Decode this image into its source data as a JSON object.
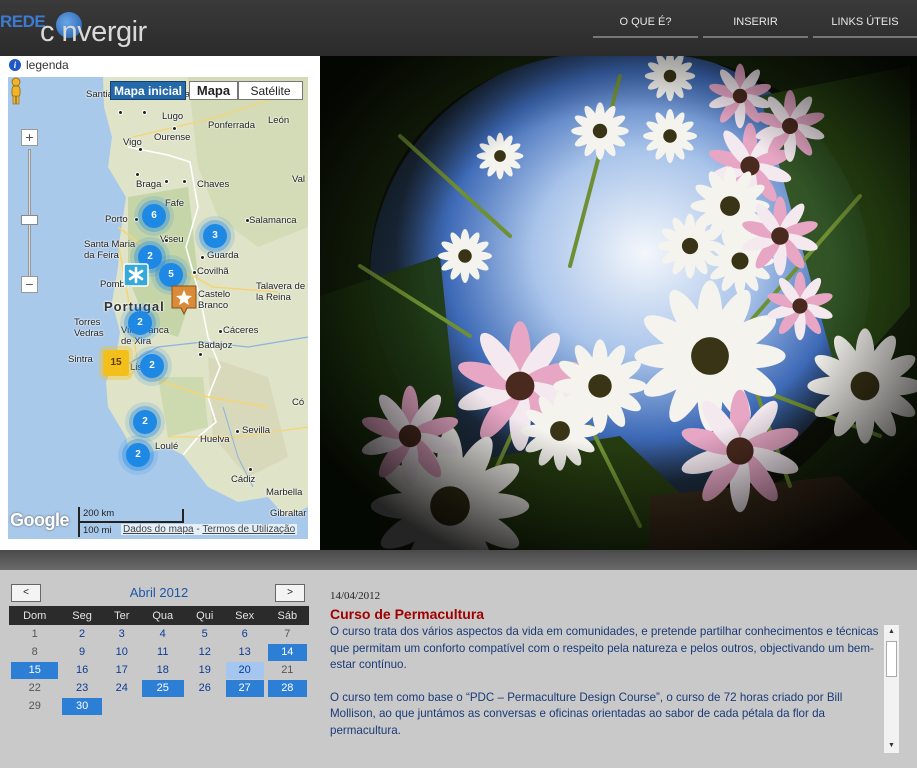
{
  "header": {
    "logo_prefix": "REDE",
    "logo_name": "c nvergir",
    "nav": [
      "O QUE É?",
      "INSERIR PROJECTO",
      "LINKS ÚTEIS"
    ]
  },
  "map": {
    "legend_label": "legenda",
    "buttons": {
      "initial": "Mapa inicial",
      "map": "Mapa",
      "satellite": "Satélite"
    },
    "google_label": "Google",
    "scale_km": "200 km",
    "scale_mi": "100 mi",
    "footer_data": "Dados do mapa",
    "footer_sep": " - ",
    "footer_terms": "Termos de Utilização",
    "cities": [
      "Santiago de Compostela",
      "Lugo",
      "Ourense",
      "Ponferrada",
      "León",
      "Vigo",
      "Braga",
      "Chaves",
      "Val",
      "Porto",
      "Fafe",
      "Viseu",
      "Salamanca",
      "Santa Maria da Feira",
      "Guarda",
      "Covilhã",
      "Pombal",
      "Castelo Branco",
      "Talavera de la Reina",
      "Torres Vedras",
      "Vila Franca de Xira",
      "Cáceres",
      "Sintra",
      "Lisboa",
      "Badajoz",
      "Có",
      "Sevilla",
      "Loulé",
      "Huelva",
      "Cádiz",
      "Marbella",
      "Gibraltar",
      "Portugal"
    ],
    "clusters": [
      "6",
      "3",
      "2",
      "5",
      "2",
      "15",
      "2",
      "2",
      "2"
    ]
  },
  "calendar": {
    "prev_label": "<",
    "next_label": ">",
    "month": "Abril 2012",
    "weekdays": [
      "Dom",
      "Seg",
      "Ter",
      "Qua",
      "Qui",
      "Sex",
      "Sáb"
    ],
    "weeks": [
      [
        "1",
        "2",
        "3",
        "4",
        "5",
        "6",
        "7"
      ],
      [
        "8",
        "9",
        "10",
        "11",
        "12",
        "13",
        "14"
      ],
      [
        "15",
        "16",
        "17",
        "18",
        "19",
        "20",
        "21"
      ],
      [
        "22",
        "23",
        "24",
        "25",
        "26",
        "27",
        "28"
      ],
      [
        "29",
        "30",
        "",
        "",
        "",
        "",
        ""
      ]
    ]
  },
  "event": {
    "date": "14/04/2012",
    "title": "Curso de Permacultura",
    "paragraphs": [
      "O curso trata dos vários aspectos da vida em comunidades, e pretende partilhar conhecimentos e técnicas que permitam um conforto compatível com o respeito pela natureza e pelos outros, objectivando um bem-estar contínuo.",
      "O curso tem como base o “PDC – Permaculture Design Course”, o curso de 72 horas criado por Bill Mollison, ao que juntámos as conversas e oficinas orientadas ao sabor de cada pétala da flor da permacultura."
    ]
  },
  "colors": {
    "accent": "#2d7fd6",
    "title_red": "#a00000",
    "cluster_blue": "#1e88e5",
    "cluster_gold": "#f3c01b"
  }
}
